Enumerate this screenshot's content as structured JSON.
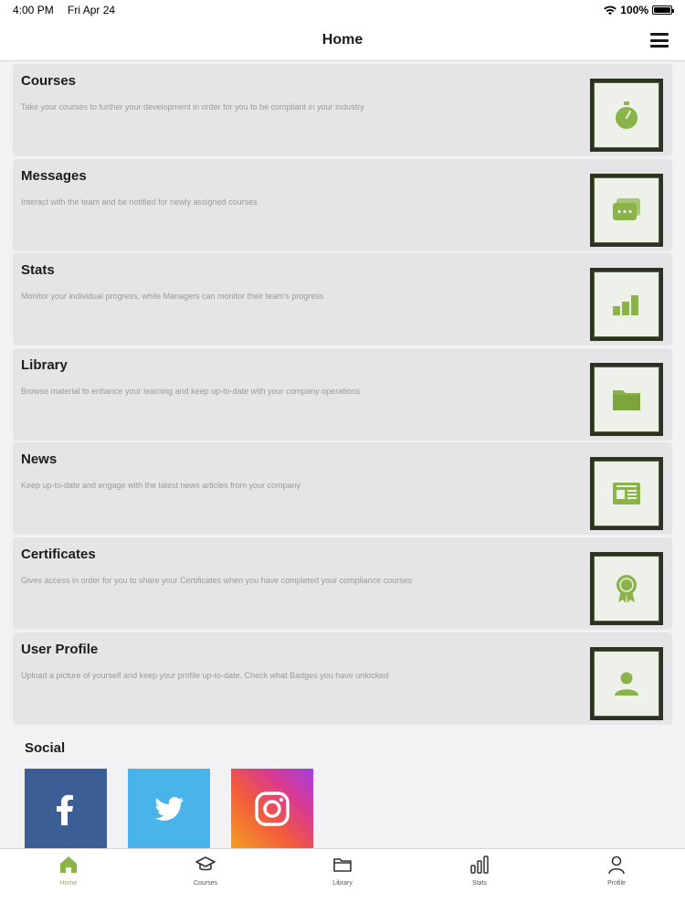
{
  "status": {
    "time": "4:00 PM",
    "date": "Fri Apr 24",
    "battery": "100%",
    "battery_level": 100
  },
  "nav": {
    "title": "Home"
  },
  "colors": {
    "accent": "#8ab34a",
    "card_bg": "#e5e5e8",
    "icon_frame": "#2b3222"
  },
  "cards": [
    {
      "title": "Courses",
      "desc": "Take your courses to further your development in order for you to be compliant in your industry",
      "icon": "stopwatch-icon"
    },
    {
      "title": "Messages",
      "desc": "Interact with the team and be notified for newly assigned courses",
      "icon": "chat-bubbles-icon"
    },
    {
      "title": "Stats",
      "desc": "Monitor your individual progress, while Managers can monitor their team's progress",
      "icon": "bar-chart-icon"
    },
    {
      "title": "Library",
      "desc": "Browse material to enhance your learning and keep up-to-date with your company operations",
      "icon": "folder-icon"
    },
    {
      "title": "News",
      "desc": "Keep up-to-date and engage with the latest news articles from your company",
      "icon": "newspaper-icon"
    },
    {
      "title": "Certificates",
      "desc": "Gives access in order for you to share your Certificates when you have completed your compliance courses",
      "icon": "award-badge-icon"
    },
    {
      "title": "User Profile",
      "desc": "Upload a picture of yourself and keep your profile up-to-date. Check what Badges you have unlocked",
      "icon": "user-icon"
    }
  ],
  "social": {
    "title": "Social",
    "items": [
      "facebook-icon",
      "twitter-icon",
      "instagram-icon"
    ]
  },
  "tabs": [
    {
      "label": "Home",
      "icon": "home-icon",
      "active": true
    },
    {
      "label": "Courses",
      "icon": "graduation-cap-icon",
      "active": false
    },
    {
      "label": "Library",
      "icon": "folder-icon",
      "active": false
    },
    {
      "label": "Stats",
      "icon": "bar-chart-icon",
      "active": false
    },
    {
      "label": "Profile",
      "icon": "user-icon",
      "active": false
    }
  ]
}
